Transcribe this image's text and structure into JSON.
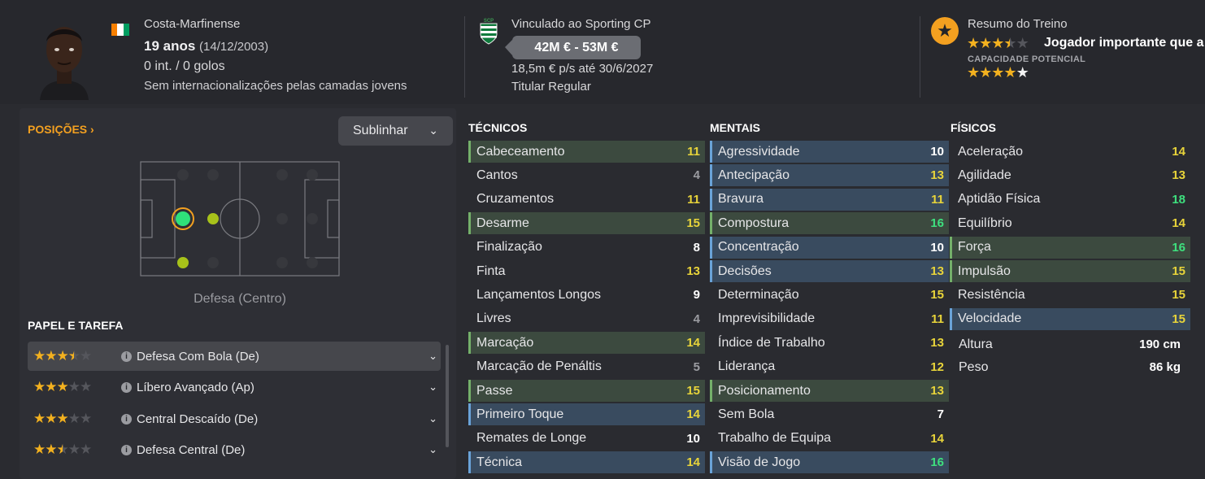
{
  "player": {
    "nationality": "Costa-Marfinense",
    "age": "19 anos",
    "dob": "(14/12/2003)",
    "caps": "0 int. / 0 golos",
    "youth_caps": "Sem internacionalizações pelas camadas jovens"
  },
  "contract": {
    "title": "Vinculado ao Sporting CP",
    "value_range": "42M € - 53M €",
    "wage": "18,5m € p/s até 30/6/2027",
    "status": "Titular Regular",
    "crest_letters": "SCP"
  },
  "training": {
    "title": "Resumo do Treino",
    "summary": "Jogador importante que a",
    "current_stars": 3.5,
    "potential_label": "CAPACIDADE POTENCIAL",
    "potential_stars": 4,
    "potential_white_stars": 1
  },
  "positions": {
    "link": "POSIÇÕES ›",
    "underline_button": "Sublinhar",
    "caption": "Defesa (Centro)"
  },
  "roles": {
    "heading": "PAPEL E TAREFA",
    "items": [
      {
        "name": "Defesa Com Bola (De)",
        "stars": 3.5,
        "selected": true
      },
      {
        "name": "Líbero Avançado (Ap)",
        "stars": 3,
        "selected": false
      },
      {
        "name": "Central Descaído (De)",
        "stars": 3,
        "selected": false
      },
      {
        "name": "Defesa Central (De)",
        "stars": 2.5,
        "selected": false
      }
    ]
  },
  "attributes": {
    "technical": {
      "heading": "TÉCNICOS",
      "items": [
        {
          "name": "Cabeceamento",
          "value": "11",
          "hl": "green"
        },
        {
          "name": "Cantos",
          "value": "4",
          "hl": ""
        },
        {
          "name": "Cruzamentos",
          "value": "11",
          "hl": ""
        },
        {
          "name": "Desarme",
          "value": "15",
          "hl": "green"
        },
        {
          "name": "Finalização",
          "value": "8",
          "hl": ""
        },
        {
          "name": "Finta",
          "value": "13",
          "hl": ""
        },
        {
          "name": "Lançamentos Longos",
          "value": "9",
          "hl": ""
        },
        {
          "name": "Livres",
          "value": "4",
          "hl": ""
        },
        {
          "name": "Marcação",
          "value": "14",
          "hl": "green"
        },
        {
          "name": "Marcação de Penáltis",
          "value": "5",
          "hl": ""
        },
        {
          "name": "Passe",
          "value": "15",
          "hl": "green"
        },
        {
          "name": "Primeiro Toque",
          "value": "14",
          "hl": "blue"
        },
        {
          "name": "Remates de Longe",
          "value": "10",
          "hl": ""
        },
        {
          "name": "Técnica",
          "value": "14",
          "hl": "blue"
        }
      ]
    },
    "mental": {
      "heading": "MENTAIS",
      "items": [
        {
          "name": "Agressividade",
          "value": "10",
          "hl": "blue"
        },
        {
          "name": "Antecipação",
          "value": "13",
          "hl": "blue"
        },
        {
          "name": "Bravura",
          "value": "11",
          "hl": "blue"
        },
        {
          "name": "Compostura",
          "value": "16",
          "hl": "green"
        },
        {
          "name": "Concentração",
          "value": "10",
          "hl": "blue"
        },
        {
          "name": "Decisões",
          "value": "13",
          "hl": "blue"
        },
        {
          "name": "Determinação",
          "value": "15",
          "hl": ""
        },
        {
          "name": "Imprevisibilidade",
          "value": "11",
          "hl": ""
        },
        {
          "name": "Índice de Trabalho",
          "value": "13",
          "hl": ""
        },
        {
          "name": "Liderança",
          "value": "12",
          "hl": ""
        },
        {
          "name": "Posicionamento",
          "value": "13",
          "hl": "green"
        },
        {
          "name": "Sem Bola",
          "value": "7",
          "hl": ""
        },
        {
          "name": "Trabalho de Equipa",
          "value": "14",
          "hl": ""
        },
        {
          "name": "Visão de Jogo",
          "value": "16",
          "hl": "blue"
        }
      ]
    },
    "physical": {
      "heading": "FÍSICOS",
      "items": [
        {
          "name": "Aceleração",
          "value": "14",
          "hl": ""
        },
        {
          "name": "Agilidade",
          "value": "13",
          "hl": ""
        },
        {
          "name": "Aptidão Física",
          "value": "18",
          "hl": ""
        },
        {
          "name": "Equilíbrio",
          "value": "14",
          "hl": ""
        },
        {
          "name": "Força",
          "value": "16",
          "hl": "green"
        },
        {
          "name": "Impulsão",
          "value": "15",
          "hl": "green"
        },
        {
          "name": "Resistência",
          "value": "15",
          "hl": ""
        },
        {
          "name": "Velocidade",
          "value": "15",
          "hl": "blue"
        }
      ],
      "height_label": "Altura",
      "height": "190 cm",
      "weight_label": "Peso",
      "weight": "86 kg"
    }
  },
  "colors": {
    "accent": "#f3a020",
    "star": "#f3b11f",
    "green_value": "#3ee07e",
    "yellow_value": "#e8d43a"
  }
}
